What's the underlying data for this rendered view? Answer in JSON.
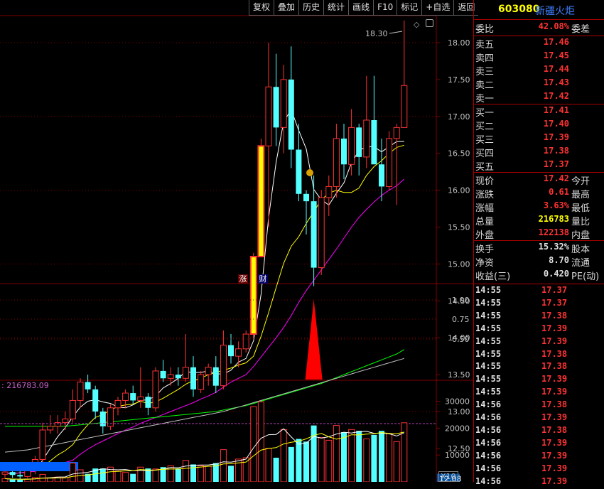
{
  "toolbar": [
    "复权",
    "叠加",
    "历史",
    "统计",
    "画线",
    "F10",
    "标记",
    "+自选",
    "返回"
  ],
  "chart_icons": {
    "diamond": "diamond-icon",
    "settings": "settings-icon"
  },
  "header": {
    "code": "603080",
    "name": "新疆火炬"
  },
  "price_axis": [
    "18.00",
    "17.50",
    "17.00",
    "16.50",
    "16.00",
    "15.50",
    "15.00",
    "14.50",
    "14.00",
    "13.50",
    "13.00",
    "12.50",
    "12.00"
  ],
  "high_label": "18.30",
  "low_label": "12.08",
  "markers": {
    "zhang": "涨",
    "cai": "财"
  },
  "indicator_axis": [
    "1.00",
    "0.75",
    "0.50"
  ],
  "volume_axis": [
    "30000",
    "20000",
    "10000"
  ],
  "volume_unit": "X10",
  "volume_readout": "216783.09",
  "colors": {
    "up": "#ff3232",
    "down": "#54ffff",
    "ma5": "#ffffff",
    "ma10": "#ffff00",
    "ma20": "#ff00ff",
    "ma60": "#00ff00",
    "ma120": "#c0c0c0",
    "grid": "#800000"
  },
  "chart_data": {
    "type": "candlestick",
    "candles": [
      [
        12.15,
        12.22,
        12.1,
        12.18
      ],
      [
        12.18,
        12.25,
        12.1,
        12.14
      ],
      [
        12.14,
        12.2,
        12.08,
        12.12
      ],
      [
        12.12,
        12.25,
        12.1,
        12.2
      ],
      [
        12.2,
        12.4,
        12.15,
        12.35
      ],
      [
        12.35,
        12.85,
        12.3,
        12.75
      ],
      [
        12.75,
        12.95,
        12.7,
        12.8
      ],
      [
        12.8,
        12.95,
        12.7,
        12.85
      ],
      [
        12.85,
        13.0,
        12.75,
        12.9
      ],
      [
        12.9,
        13.3,
        12.85,
        13.15
      ],
      [
        13.15,
        13.45,
        13.05,
        13.4
      ],
      [
        13.4,
        13.5,
        13.25,
        13.3
      ],
      [
        13.3,
        13.35,
        12.9,
        13.0
      ],
      [
        13.0,
        13.05,
        12.7,
        12.8
      ],
      [
        12.8,
        13.1,
        12.75,
        13.05
      ],
      [
        13.05,
        13.2,
        12.95,
        13.15
      ],
      [
        13.15,
        13.3,
        13.05,
        13.25
      ],
      [
        13.25,
        13.35,
        13.1,
        13.15
      ],
      [
        13.15,
        13.6,
        13.05,
        13.2
      ],
      [
        13.2,
        13.25,
        12.95,
        13.05
      ],
      [
        13.05,
        13.6,
        13.0,
        13.55
      ],
      [
        13.55,
        13.7,
        13.4,
        13.45
      ],
      [
        13.45,
        13.6,
        13.35,
        13.5
      ],
      [
        13.5,
        13.6,
        13.35,
        13.45
      ],
      [
        13.45,
        14.05,
        13.4,
        13.6
      ],
      [
        13.6,
        13.75,
        13.2,
        13.3
      ],
      [
        13.3,
        13.55,
        13.25,
        13.5
      ],
      [
        13.5,
        13.65,
        13.35,
        13.6
      ],
      [
        13.6,
        13.75,
        13.25,
        13.35
      ],
      [
        13.35,
        14.1,
        13.3,
        13.9
      ],
      [
        13.9,
        14.05,
        13.65,
        13.75
      ],
      [
        13.75,
        13.95,
        13.6,
        13.85
      ],
      [
        13.85,
        14.1,
        13.8,
        14.05
      ],
      [
        14.05,
        15.15,
        14.0,
        15.1
      ],
      [
        15.1,
        16.7,
        15.5,
        16.6
      ],
      [
        16.6,
        18.0,
        15.5,
        17.4
      ],
      [
        17.4,
        17.85,
        16.6,
        16.85
      ],
      [
        16.85,
        17.7,
        16.5,
        17.5
      ],
      [
        17.5,
        17.95,
        16.3,
        16.55
      ],
      [
        16.55,
        16.9,
        15.85,
        15.95
      ],
      [
        15.95,
        16.0,
        15.4,
        15.85
      ],
      [
        15.85,
        16.2,
        14.7,
        14.95
      ],
      [
        14.95,
        16.0,
        14.85,
        15.9
      ],
      [
        15.9,
        16.2,
        15.65,
        16.05
      ],
      [
        16.05,
        16.9,
        15.9,
        16.7
      ],
      [
        16.7,
        16.9,
        16.15,
        16.35
      ],
      [
        16.35,
        17.1,
        16.2,
        16.85
      ],
      [
        16.85,
        16.9,
        16.2,
        16.45
      ],
      [
        16.45,
        17.55,
        16.3,
        16.95
      ],
      [
        16.95,
        17.55,
        16.4,
        16.35
      ],
      [
        16.35,
        16.7,
        15.85,
        16.05
      ],
      [
        16.05,
        16.8,
        16.0,
        16.7
      ],
      [
        16.7,
        16.9,
        15.8,
        16.85
      ],
      [
        16.85,
        18.3,
        16.95,
        17.42
      ]
    ],
    "volumes": [
      1200,
      900,
      800,
      1100,
      1600,
      2800,
      1500,
      1800,
      1600,
      7000,
      4500,
      3000,
      5000,
      5000,
      5500,
      4000,
      3500,
      3000,
      5500,
      5000,
      4800,
      5500,
      6000,
      5000,
      8000,
      6500,
      6000,
      5800,
      7000,
      12000,
      6000,
      8500,
      9000,
      28000,
      29800,
      12500,
      9000,
      19500,
      13000,
      16000,
      15000,
      21000,
      16500,
      15500,
      21000,
      18500,
      19500,
      19000,
      16000,
      17500,
      19000,
      18000,
      15000,
      22000
    ],
    "ma_lines": {
      "ma5": [
        12.16,
        12.16,
        12.17,
        12.18,
        12.2,
        12.34,
        12.5,
        12.66,
        12.78,
        12.93,
        13.06,
        13.14,
        13.16,
        13.13,
        13.11,
        13.06,
        13.05,
        13.09,
        13.15,
        13.16,
        13.21,
        13.32,
        13.38,
        13.45,
        13.54,
        13.53,
        13.53,
        13.55,
        13.51,
        13.51,
        13.56,
        13.67,
        13.72,
        13.96,
        14.59,
        15.63,
        16.38,
        16.93,
        17.09,
        16.81,
        16.56,
        16.01,
        15.87,
        15.8,
        15.96,
        16.1,
        16.37,
        16.54,
        16.59,
        16.59,
        16.52,
        16.59,
        16.66,
        16.66
      ],
      "ma10": [
        12.16,
        12.16,
        12.17,
        12.18,
        12.19,
        12.25,
        12.33,
        12.41,
        12.47,
        12.55,
        12.7,
        12.82,
        12.92,
        12.96,
        13.02,
        13.07,
        13.09,
        13.1,
        13.14,
        13.11,
        13.13,
        13.18,
        13.24,
        13.3,
        13.37,
        13.42,
        13.45,
        13.5,
        13.53,
        13.56,
        13.59,
        13.63,
        13.66,
        13.75,
        14.02,
        14.34,
        14.68,
        15.01,
        15.24,
        15.37,
        15.55,
        15.71,
        15.87,
        15.96,
        16.0,
        15.97,
        15.97,
        16.03,
        16.2,
        16.32,
        16.4,
        16.5,
        16.58,
        16.61
      ],
      "ma20": [
        12.16,
        12.16,
        12.17,
        12.18,
        12.19,
        12.22,
        12.25,
        12.28,
        12.31,
        12.34,
        12.42,
        12.49,
        12.55,
        12.6,
        12.65,
        12.7,
        12.75,
        12.79,
        12.84,
        12.88,
        12.92,
        12.96,
        13.0,
        13.04,
        13.08,
        13.12,
        13.17,
        13.21,
        13.26,
        13.33,
        13.4,
        13.45,
        13.5,
        13.61,
        13.74,
        13.87,
        14.0,
        14.14,
        14.3,
        14.48,
        14.64,
        14.78,
        14.92,
        15.06,
        15.2,
        15.35,
        15.5,
        15.63,
        15.74,
        15.84,
        15.93,
        16.0,
        16.06,
        16.15
      ],
      "ma60": [
        12.8,
        12.8,
        12.8,
        12.8,
        12.8,
        12.8,
        12.8,
        12.8,
        12.8,
        12.81,
        12.82,
        12.83,
        12.84,
        12.85,
        12.86,
        12.87,
        12.88,
        12.89,
        12.9,
        12.91,
        12.92,
        12.93,
        12.94,
        12.95,
        12.96,
        12.97,
        12.98,
        12.99,
        13.0,
        13.02,
        13.04,
        13.06,
        13.08,
        13.11,
        13.14,
        13.17,
        13.2,
        13.23,
        13.26,
        13.29,
        13.32,
        13.35,
        13.38,
        13.42,
        13.46,
        13.5,
        13.54,
        13.58,
        13.62,
        13.66,
        13.7,
        13.74,
        13.78,
        13.84
      ],
      "ma120": [
        12.45,
        12.46,
        12.47,
        12.48,
        12.5,
        12.52,
        12.54,
        12.56,
        12.58,
        12.6,
        12.62,
        12.64,
        12.66,
        12.68,
        12.7,
        12.72,
        12.74,
        12.76,
        12.78,
        12.8,
        12.82,
        12.84,
        12.86,
        12.88,
        12.9,
        12.92,
        12.94,
        12.96,
        12.98,
        13.0,
        13.03,
        13.06,
        13.09,
        13.12,
        13.15,
        13.18,
        13.21,
        13.24,
        13.27,
        13.3,
        13.33,
        13.36,
        13.39,
        13.42,
        13.45,
        13.48,
        13.51,
        13.54,
        13.57,
        13.6,
        13.63,
        13.66,
        13.69,
        13.72
      ]
    },
    "signal_peak_value": 1.0
  },
  "quote": {
    "wei_label": "委比",
    "wei_value": "42.08%",
    "wei_label2": "委差",
    "asks": [
      {
        "l": "卖五",
        "v": "17.46"
      },
      {
        "l": "卖四",
        "v": "17.45"
      },
      {
        "l": "卖三",
        "v": "17.44"
      },
      {
        "l": "卖二",
        "v": "17.43"
      },
      {
        "l": "卖一",
        "v": "17.42"
      }
    ],
    "bids": [
      {
        "l": "买一",
        "v": "17.41"
      },
      {
        "l": "买二",
        "v": "17.40"
      },
      {
        "l": "买三",
        "v": "17.39"
      },
      {
        "l": "买四",
        "v": "17.38"
      },
      {
        "l": "买五",
        "v": "17.37"
      }
    ],
    "stats": [
      {
        "l": "现价",
        "v": "17.42",
        "c": "#ff3232",
        "l2": "今开"
      },
      {
        "l": "涨跌",
        "v": "0.61",
        "c": "#ff3232",
        "l2": "最高"
      },
      {
        "l": "涨幅",
        "v": "3.63%",
        "c": "#ff3232",
        "l2": "最低"
      },
      {
        "l": "总量",
        "v": "216783",
        "c": "#ffff00",
        "l2": "量比"
      },
      {
        "l": "外盘",
        "v": "122138",
        "c": "#ff3232",
        "l2": "内盘"
      }
    ],
    "stats2": [
      {
        "l": "换手",
        "v": "15.32%",
        "c": "#e0e0e0",
        "l2": "股本"
      },
      {
        "l": "净资",
        "v": "8.70",
        "c": "#e0e0e0",
        "l2": "流通"
      },
      {
        "l": "收益(三)",
        "v": "0.420",
        "c": "#e0e0e0",
        "l2": "PE(动)"
      }
    ]
  },
  "ticks": [
    {
      "t": "14:55",
      "p": "17.37"
    },
    {
      "t": "14:55",
      "p": "17.37"
    },
    {
      "t": "14:55",
      "p": "17.38"
    },
    {
      "t": "14:55",
      "p": "17.39"
    },
    {
      "t": "14:55",
      "p": "17.39"
    },
    {
      "t": "14:55",
      "p": "17.38"
    },
    {
      "t": "14:55",
      "p": "17.38"
    },
    {
      "t": "14:55",
      "p": "17.39"
    },
    {
      "t": "14:55",
      "p": "17.39"
    },
    {
      "t": "14:56",
      "p": "17.38"
    },
    {
      "t": "14:56",
      "p": "17.39"
    },
    {
      "t": "14:56",
      "p": "17.38"
    },
    {
      "t": "14:56",
      "p": "17.39"
    },
    {
      "t": "14:56",
      "p": "17.39"
    },
    {
      "t": "14:56",
      "p": "17.39"
    },
    {
      "t": "14:56",
      "p": "17.39"
    }
  ]
}
